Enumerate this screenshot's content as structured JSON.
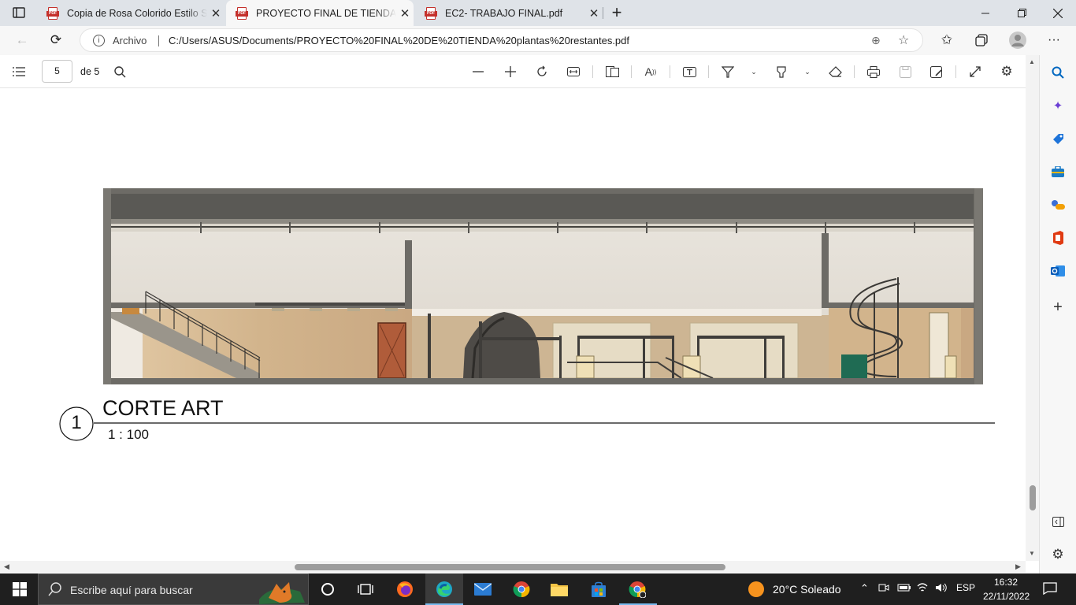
{
  "tabs": [
    {
      "title": "Copia de Rosa Colorido Estilo Se",
      "icon": "pdf-icon"
    },
    {
      "title": "PROYECTO FINAL DE TIENDA pla",
      "icon": "pdf-icon"
    },
    {
      "title": "EC2- TRABAJO FINAL.pdf",
      "icon": "pdf-icon"
    }
  ],
  "address": {
    "scheme_label": "Archivo",
    "url": "C:/Users/ASUS/Documents/PROYECTO%20FINAL%20DE%20TIENDA%20plantas%20restantes.pdf"
  },
  "pdf_toolbar": {
    "page_current": "5",
    "page_of": "de 5"
  },
  "drawing": {
    "view_number": "1",
    "view_title": "CORTE ART",
    "scale": "1 : 100"
  },
  "taskbar": {
    "search_placeholder": "Escribe aquí para buscar",
    "weather": "20°C  Soleado",
    "lang": "ESP",
    "time": "16:32",
    "date": "22/11/2022"
  },
  "colors": {
    "accent_blue": "#0067c0",
    "pdf_red": "#c4302b",
    "taskbar_bg": "#1f1f1f"
  }
}
